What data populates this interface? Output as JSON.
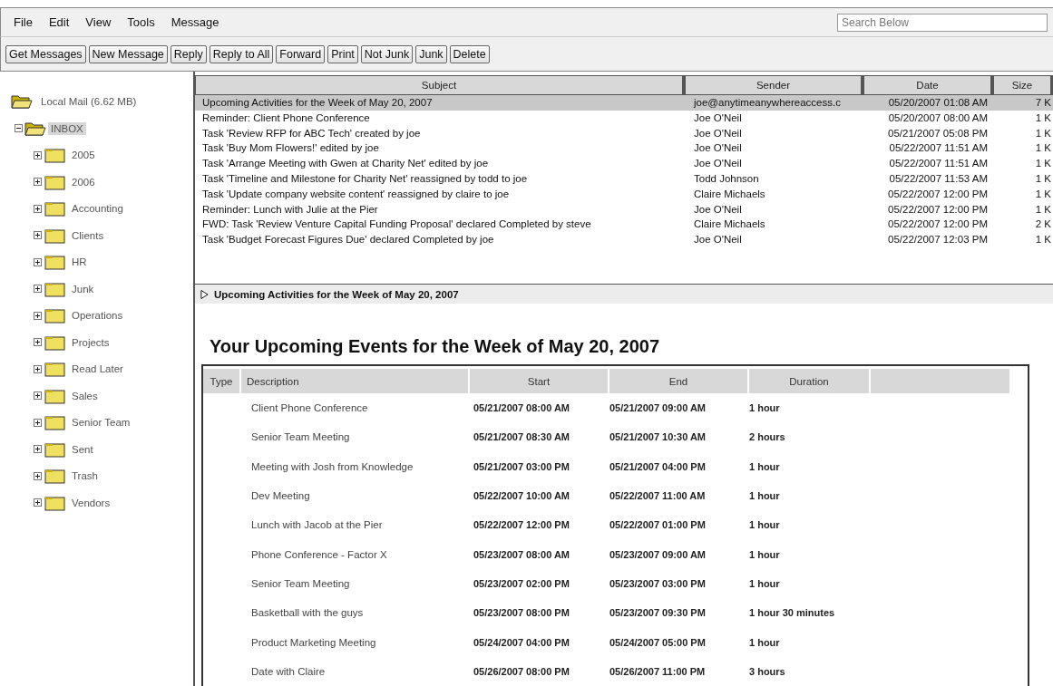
{
  "menu": [
    "File",
    "Edit",
    "View",
    "Tools",
    "Message"
  ],
  "search": {
    "placeholder": "Search Below"
  },
  "toolbar": [
    "Get Messages",
    "New Message",
    "Reply",
    "Reply to All",
    "Forward",
    "Print",
    "Not Junk",
    "Junk",
    "Delete"
  ],
  "folders": {
    "label": "Local Mail (6.62 MB)",
    "children": [
      {
        "label": "INBOX",
        "expanded": true,
        "selected": true,
        "children": [
          {
            "label": "2005",
            "expanded": false,
            "selected": false
          },
          {
            "label": "2006",
            "expanded": false,
            "selected": false
          },
          {
            "label": "Accounting",
            "expanded": false,
            "selected": false
          },
          {
            "label": "Clients",
            "expanded": false,
            "selected": false
          },
          {
            "label": "HR",
            "expanded": false,
            "selected": false
          },
          {
            "label": "Junk",
            "expanded": false,
            "selected": false
          },
          {
            "label": "Operations",
            "expanded": false,
            "selected": false
          },
          {
            "label": "Projects",
            "expanded": false,
            "selected": false
          },
          {
            "label": "Read Later",
            "expanded": false,
            "selected": false
          },
          {
            "label": "Sales",
            "expanded": false,
            "selected": false
          },
          {
            "label": "Senior Team",
            "expanded": false,
            "selected": false
          },
          {
            "label": "Sent",
            "expanded": false,
            "selected": false
          },
          {
            "label": "Trash",
            "expanded": false,
            "selected": false
          },
          {
            "label": "Vendors",
            "expanded": false,
            "selected": false
          }
        ]
      }
    ]
  },
  "messages": {
    "columns": [
      "Subject",
      "Sender",
      "Date",
      "Size"
    ],
    "rows": [
      {
        "subject": "Upcoming Activities for the Week of May 20, 2007",
        "sender": "joe@anytimeanywhereaccess.c",
        "date": "05/20/2007 01:08 AM",
        "size": "7 K",
        "selected": true
      },
      {
        "subject": "Reminder: Client Phone Conference",
        "sender": "Joe O'Neil",
        "date": "05/20/2007 08:00 AM",
        "size": "1 K",
        "selected": false
      },
      {
        "subject": "Task 'Review RFP for ABC Tech' created by joe",
        "sender": "Joe O'Neil",
        "date": "05/21/2007 05:08 PM",
        "size": "1 K",
        "selected": false
      },
      {
        "subject": "Task 'Buy Mom Flowers!' edited by joe",
        "sender": "Joe O'Neil",
        "date": "05/22/2007 11:51 AM",
        "size": "1 K",
        "selected": false
      },
      {
        "subject": "Task 'Arrange Meeting with Gwen at Charity Net' edited by joe",
        "sender": "Joe O'Neil",
        "date": "05/22/2007 11:51 AM",
        "size": "1 K",
        "selected": false
      },
      {
        "subject": "Task 'Timeline and Milestone for Charity Net' reassigned by todd to joe",
        "sender": "Todd Johnson",
        "date": "05/22/2007 11:53 AM",
        "size": "1 K",
        "selected": false
      },
      {
        "subject": "Task 'Update company website content' reassigned by claire to joe",
        "sender": "Claire Michaels",
        "date": "05/22/2007 12:00 PM",
        "size": "1 K",
        "selected": false
      },
      {
        "subject": "Reminder: Lunch with Julie at the Pier",
        "sender": "Joe O'Neil",
        "date": "05/22/2007 12:00 PM",
        "size": "1 K",
        "selected": false
      },
      {
        "subject": "FWD: Task 'Review Venture Capital Funding Proposal' declared Completed by steve",
        "sender": "Claire Michaels",
        "date": "05/22/2007 12:00 PM",
        "size": "2 K",
        "selected": false
      },
      {
        "subject": "Task 'Budget Forecast Figures Due' declared Completed by joe",
        "sender": "Joe O'Neil",
        "date": "05/22/2007 12:03 PM",
        "size": "1 K",
        "selected": false
      }
    ]
  },
  "preview": {
    "header": "Upcoming Activities for the Week of May 20, 2007",
    "expanded": false,
    "title": "Your Upcoming Events for the Week of May 20, 2007",
    "columns": [
      "Type",
      "Description",
      "Start",
      "End",
      "Duration"
    ],
    "rows": [
      {
        "description": "Client Phone Conference",
        "start": "05/21/2007 08:00 AM",
        "end": "05/21/2007 09:00 AM",
        "duration": "1 hour"
      },
      {
        "description": "Senior Team Meeting",
        "start": "05/21/2007 08:30 AM",
        "end": "05/21/2007 10:30 AM",
        "duration": "2 hours"
      },
      {
        "description": "Meeting with Josh from Knowledge",
        "start": "05/21/2007 03:00 PM",
        "end": "05/21/2007 04:00 PM",
        "duration": "1 hour"
      },
      {
        "description": "Dev Meeting",
        "start": "05/22/2007 10:00 AM",
        "end": "05/22/2007 11:00 AM",
        "duration": "1 hour"
      },
      {
        "description": "Lunch with Jacob at the Pier",
        "start": "05/22/2007 12:00 PM",
        "end": "05/22/2007 01:00 PM",
        "duration": "1 hour"
      },
      {
        "description": "Phone Conference - Factor X",
        "start": "05/23/2007 08:00 AM",
        "end": "05/23/2007 09:00 AM",
        "duration": "1 hour"
      },
      {
        "description": "Senior Team Meeting",
        "start": "05/23/2007 02:00 PM",
        "end": "05/23/2007 03:00 PM",
        "duration": "1 hour"
      },
      {
        "description": "Basketball with the guys",
        "start": "05/23/2007 08:00 PM",
        "end": "05/23/2007 09:30 PM",
        "duration": "1 hour 30 minutes"
      },
      {
        "description": "Product Marketing Meeting",
        "start": "05/24/2007 04:00 PM",
        "end": "05/24/2007 05:00 PM",
        "duration": "1 hour"
      },
      {
        "description": "Date with Claire",
        "start": "05/26/2007 08:00 PM",
        "end": "05/26/2007 11:00 PM",
        "duration": "3 hours"
      }
    ]
  }
}
